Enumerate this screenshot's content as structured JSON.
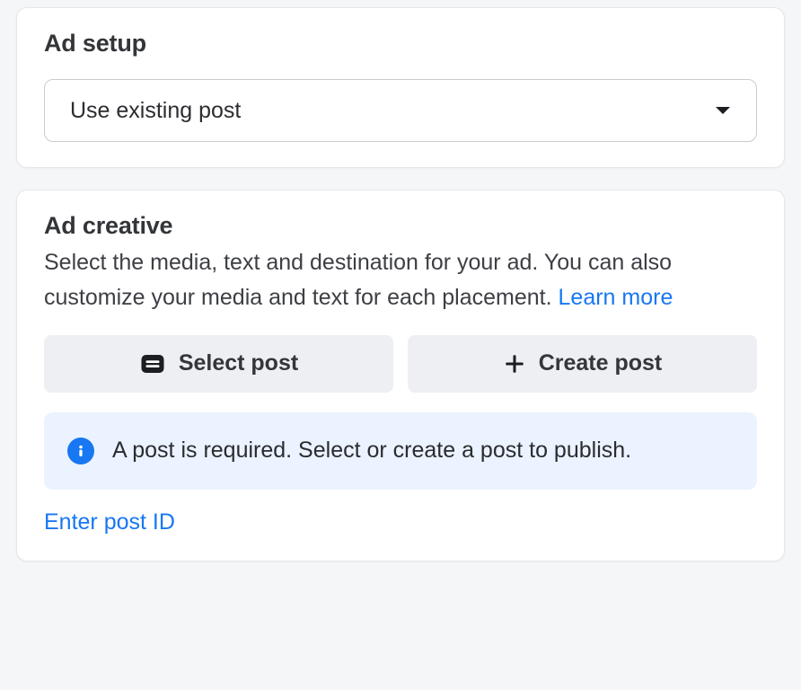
{
  "ad_setup": {
    "title": "Ad setup",
    "dropdown_value": "Use existing post"
  },
  "ad_creative": {
    "title": "Ad creative",
    "subtitle_pre": "Select the media, text and destination for your ad. You can also customize your media and text for each placement. ",
    "learn_more": "Learn more",
    "select_post_label": "Select post",
    "create_post_label": "Create post",
    "info_message": "A post is required. Select or create a post to publish.",
    "enter_post_id": "Enter post ID"
  }
}
